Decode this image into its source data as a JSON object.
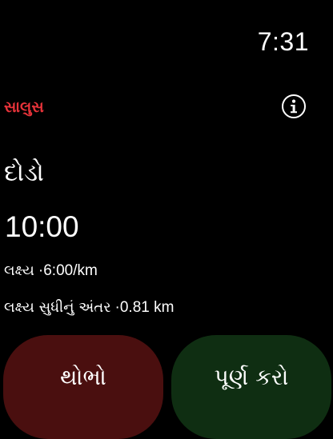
{
  "status_bar": {
    "time": "7:31"
  },
  "header": {
    "title": "સાલુસ",
    "title_color": "#e8333a",
    "info_icon": "info-icon"
  },
  "workout": {
    "name": "દોડો",
    "elapsed_time": "10:00",
    "target_pace_label": "લક્ષ્ય",
    "target_pace_value": "·6:00/km",
    "distance_to_target_label": "લક્ષ્ય સુધીનું અંતર",
    "distance_to_target_value": "·0.81 km"
  },
  "actions": {
    "stop_label": "થોભો",
    "stop_color": "#4a0f0f",
    "finish_label": "પૂર્ણ કરો",
    "finish_color": "#0f2e12"
  }
}
